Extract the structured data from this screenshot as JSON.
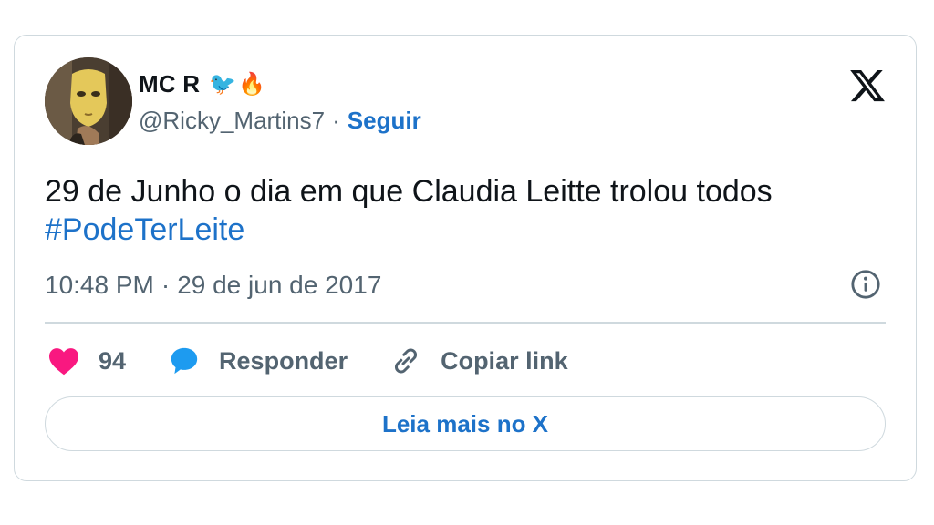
{
  "author": {
    "name": "MC R",
    "emojis": [
      "🐦",
      "🔥"
    ],
    "handle": "@Ricky_Martins7",
    "separator": "·",
    "follow_label": "Seguir"
  },
  "tweet": {
    "text": "29 de Junho o dia em que Claudia Leitte trolou todos",
    "hashtag": "#PodeTerLeite",
    "time": "10:48 PM",
    "separator": "·",
    "date": "29 de jun de 2017"
  },
  "actions": {
    "likes_count": "94",
    "reply_label": "Responder",
    "copy_link_label": "Copiar link"
  },
  "read_more_label": "Leia mais no X",
  "icons": {
    "platform": "x-logo-icon",
    "info": "info-icon",
    "like": "heart-icon",
    "reply": "speech-bubble-icon",
    "copy": "link-icon"
  },
  "colors": {
    "accent": "#1d72c9",
    "heart": "#f91880",
    "reply_bubble": "#1d9bf0",
    "muted": "#536471",
    "border": "#cfd9de"
  }
}
